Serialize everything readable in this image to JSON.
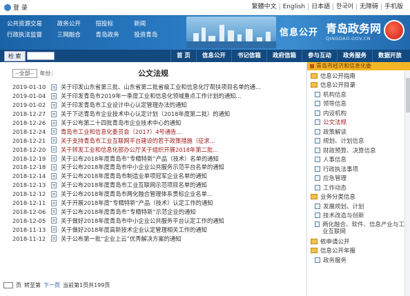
{
  "topbar": {
    "login_label": "登 录",
    "links": [
      "繁體中文",
      "English",
      "日本語",
      "한국어",
      "无障碍",
      "手机版"
    ]
  },
  "banner": {
    "links": [
      "公共资源交易",
      "政务公开",
      "招投标",
      "新闻",
      "行政执法监督",
      "三网融合",
      "青岛政务",
      "投资青岛"
    ],
    "tagline": "信息公开",
    "logo_cn": "青岛政务网",
    "logo_en": "QINGDAO.GOV.CN"
  },
  "nav": {
    "search_button": "检 索",
    "items": [
      "首 页",
      "信息公开",
      "书记信箱",
      "政府信箱",
      "参与互动",
      "政务服务",
      "数据开放"
    ]
  },
  "crumb": "青岛市经济和信息化委",
  "main": {
    "title": "公文法规",
    "filter_label": "年份：",
    "filter_value": "--全部--",
    "rows": [
      {
        "date": "2019-01-10",
        "title": "关于印发山东省第三批、山东省第二批省级工业和信息化厅帮扶项目名单的通...",
        "red": false
      },
      {
        "date": "2019-01-04",
        "title": "关于印发青岛市2019年一季度工业和信息化领域重点工作计划的通知...",
        "red": false
      },
      {
        "date": "2019-01-02",
        "title": "关于印发青岛市工业设计中心认定管理办法的通知",
        "red": false
      },
      {
        "date": "2018-12-27",
        "title": "关于下达青岛市企业技术中心认定计划（2018年度第二批）的通知",
        "red": false
      },
      {
        "date": "2018-12-26",
        "title": "关于公布第二十四批青岛市企业技术中心的通知",
        "red": false
      },
      {
        "date": "2018-12-24",
        "title": "青岛市工业和信息化委员会（2017）4号通告...",
        "red": true
      },
      {
        "date": "2018-12-21",
        "title": "关于支持青岛市工业互联网平台建设的若干政策措施（征求...",
        "red": true
      },
      {
        "date": "2018-12-20",
        "title": "关于转发工业和信息化部办公厅关于组织开展2018年第二批...",
        "red": true
      },
      {
        "date": "2018-12-19",
        "title": "关于公布2018年度青岛市“专精特新”产品（技术）名单的通知",
        "red": false
      },
      {
        "date": "2018-12-18",
        "title": "关于公布2018年度青岛市中小企业公共服务示范平台名单的通知",
        "red": false
      },
      {
        "date": "2018-12-14",
        "title": "关于公布2018年度青岛市制造业单项冠军企业名单的通知",
        "red": false
      },
      {
        "date": "2018-12-13",
        "title": "关于公布2018年度青岛市工业互联网示范项目名单的通知",
        "red": false
      },
      {
        "date": "2018-12-12",
        "title": "关于公布2018年度青岛市两化融合管理体系贯标企业名单...",
        "red": false
      },
      {
        "date": "2018-12-11",
        "title": "关于开展2018年度“专精特新”产品（技术）认定工作的通知",
        "red": false
      },
      {
        "date": "2018-12-06",
        "title": "关于公布2018年度青岛市“专精特新”示范企业的通知",
        "red": false
      },
      {
        "date": "2018-12-05",
        "title": "关于做好2018年度青岛市中小企业公共服务平台认定工作的通知",
        "red": false
      },
      {
        "date": "2018-11-13",
        "title": "关于做好2018年度高新技术企业认定管理相关工作的通知",
        "red": false
      },
      {
        "date": "2018-11-12",
        "title": "关于公布第一批“企业上云”优秀解决方案的通知",
        "red": false
      }
    ],
    "pager": {
      "summary": "当前第1页共199页",
      "next": "下一页",
      "jump": "转至第",
      "page_suffix": "页"
    }
  },
  "sidebar": {
    "items": [
      {
        "label": "信息公开指南",
        "type": "folder"
      },
      {
        "label": "信息公开目录",
        "type": "folder"
      },
      {
        "label": "机构信息",
        "type": "sub"
      },
      {
        "label": "领导信息",
        "type": "sub"
      },
      {
        "label": "内设机构",
        "type": "sub"
      },
      {
        "label": "公文法规",
        "type": "sub",
        "red": true
      },
      {
        "label": "政策解读",
        "type": "sub"
      },
      {
        "label": "规划、计划信息",
        "type": "sub"
      },
      {
        "label": "财政预算、决算信息",
        "type": "sub"
      },
      {
        "label": "人事信息",
        "type": "sub"
      },
      {
        "label": "行政执法事项",
        "type": "sub"
      },
      {
        "label": "应急管理",
        "type": "sub"
      },
      {
        "label": "工作动态",
        "type": "sub"
      },
      {
        "label": "业务分类信息",
        "type": "folder"
      },
      {
        "label": "发展规划、计划",
        "type": "sub"
      },
      {
        "label": "技术改造与创新",
        "type": "sub"
      },
      {
        "label": "两化融合、软件、信息产业与工业互联网",
        "type": "sub",
        "tall": true
      },
      {
        "label": "依申请公开",
        "type": "folder"
      },
      {
        "label": "信息公开年报",
        "type": "folder"
      },
      {
        "label": "政务服务",
        "type": "sub"
      }
    ]
  }
}
